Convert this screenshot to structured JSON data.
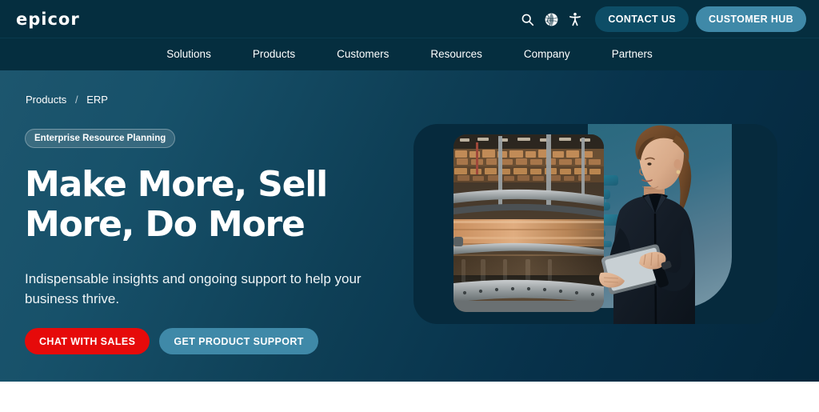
{
  "header": {
    "logo_text": "epicor",
    "icons": [
      {
        "name": "search-icon",
        "label": "Search"
      },
      {
        "name": "globe-icon",
        "label": "Language"
      },
      {
        "name": "accessibility-icon",
        "label": "Accessibility"
      }
    ],
    "contact_label": "CONTACT US",
    "customer_hub_label": "CUSTOMER HUB",
    "contact_color": "#0d4d66",
    "customer_hub_color": "#3f89a8",
    "bar_color": "#052e3f"
  },
  "nav": {
    "items": [
      {
        "label": "Solutions"
      },
      {
        "label": "Products"
      },
      {
        "label": "Customers"
      },
      {
        "label": "Resources"
      },
      {
        "label": "Company"
      },
      {
        "label": "Partners"
      }
    ]
  },
  "hero": {
    "breadcrumb": {
      "parent": "Products",
      "separator": "/",
      "current": "ERP"
    },
    "badge": "Enterprise Resource Planning",
    "headline": "Make More, Sell More, Do More",
    "subtext": "Indispensable insights and ongoing support to help your business thrive.",
    "cta_primary": "CHAT WITH SALES",
    "cta_secondary": "GET PRODUCT SUPPORT",
    "cta_primary_color": "#e60a0a",
    "cta_secondary_color": "#3f89a8",
    "background_from": "#1d566e",
    "background_to": "#04273c",
    "media": {
      "photo_alt": "warehouse-conveyor-photo",
      "figure_alt": "woman-with-tablet",
      "overlay_alt": "circuit-pattern-overlay"
    }
  }
}
